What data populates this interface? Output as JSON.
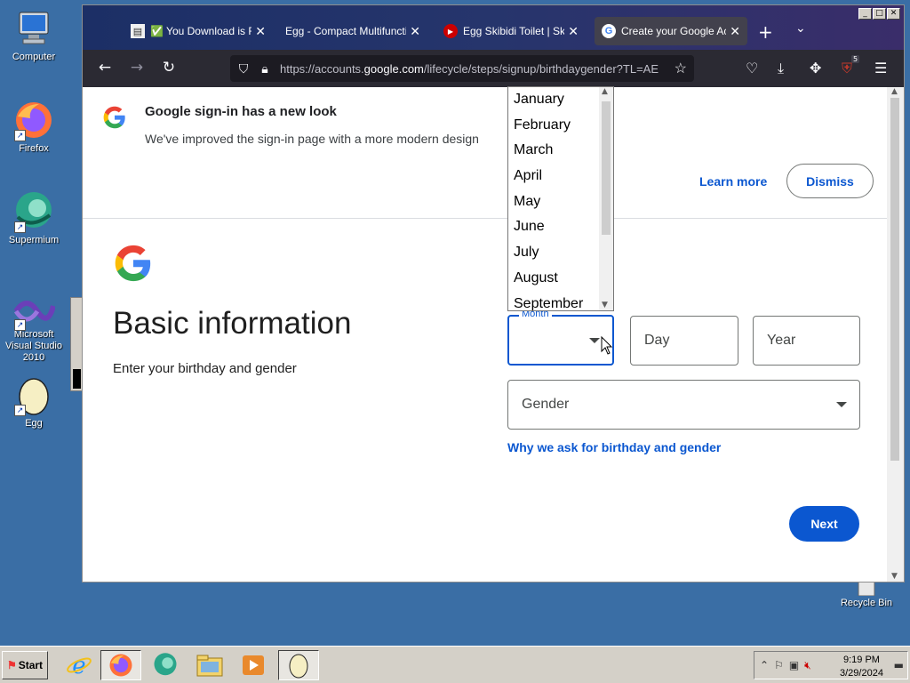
{
  "desktop": {
    "icons": [
      {
        "label": "Computer"
      },
      {
        "label": "Firefox"
      },
      {
        "label": "Supermium"
      },
      {
        "label": "Microsoft Visual Studio 2010"
      },
      {
        "label": "Egg"
      },
      {
        "label": "Recycle Bin"
      }
    ]
  },
  "browser": {
    "tabs": [
      {
        "title": "✅ You Download is Read"
      },
      {
        "title": "Egg - Compact Multifunction T"
      },
      {
        "title": "Egg Skibidi Toilet | Skibidi"
      },
      {
        "title": "Create your Google Acco"
      }
    ],
    "url_prefix": "https://accounts.",
    "url_domain": "google.com",
    "url_suffix": "/lifecycle/steps/signup/birthdaygender?TL=AE",
    "extension_badge": "5"
  },
  "page": {
    "notice_title": "Google sign-in has a new look",
    "notice_sub": "We've improved the sign-in page with a more modern design",
    "learn_more": "Learn more",
    "dismiss": "Dismiss",
    "title": "Basic information",
    "subtitle": "Enter your birthday and gender",
    "month_label": "Month",
    "day_placeholder": "Day",
    "year_placeholder": "Year",
    "gender_placeholder": "Gender",
    "why_link": "Why we ask for birthday and gender",
    "next": "Next"
  },
  "month_dropdown": {
    "options": [
      "January",
      "February",
      "March",
      "April",
      "May",
      "June",
      "July",
      "August",
      "September"
    ]
  },
  "taskbar": {
    "start": "Start",
    "time": "9:19 PM",
    "date": "3/29/2024"
  },
  "colors": {
    "google_blue": "#0b57d0",
    "desktop": "#3a6ea5"
  }
}
